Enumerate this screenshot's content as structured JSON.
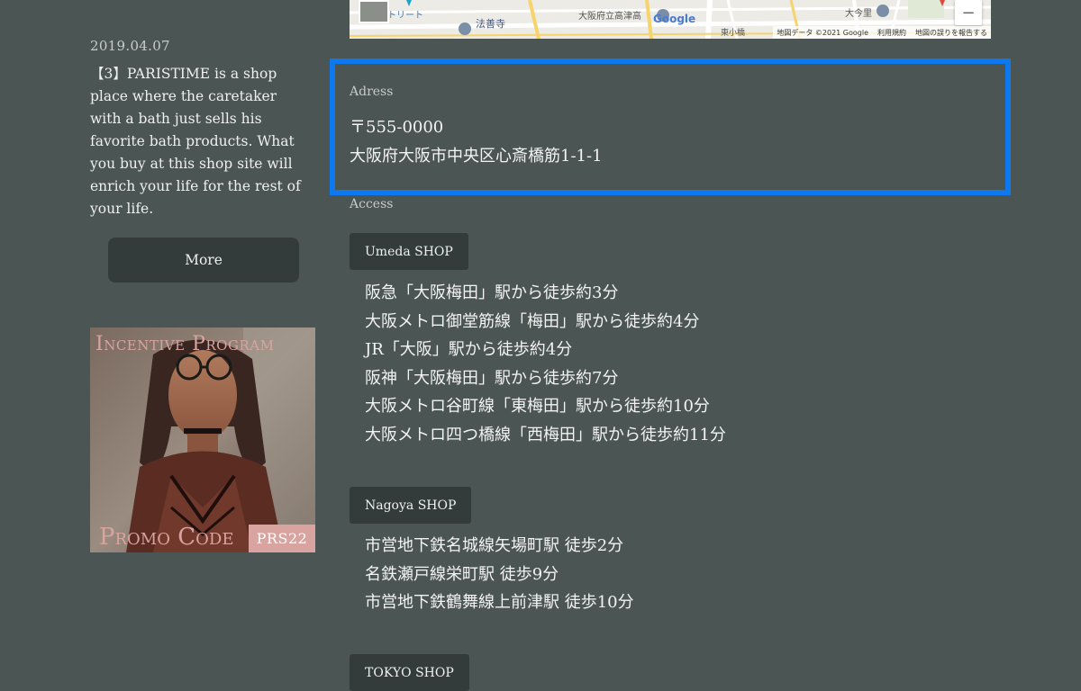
{
  "news": {
    "date": "2019.04.07",
    "text": "【3】PARISTIME is a shop place where the caretaker with a bath just sells his favorite bath products. What you buy at this shop site will enrich your life for the rest of your life.",
    "more_label": "More"
  },
  "promo": {
    "title": "Incentive Program",
    "code_label": "Promo Code",
    "code": "PRS22"
  },
  "map": {
    "labels": [
      "トリート",
      "法善寺",
      "大阪府立高津高",
      "大今里",
      "東小橋"
    ],
    "zoom_out_label": "−",
    "footer": [
      "地図データ ©2021 Google",
      "利用規約",
      "地図の誤りを報告する"
    ],
    "brand": "Google"
  },
  "address": {
    "label": "Adress",
    "postal": "〒555-0000",
    "street": "大阪府大阪市中央区心斎橋筋1-1-1"
  },
  "access": {
    "label": "Access",
    "shops": [
      {
        "name": "Umeda SHOP",
        "routes": [
          "阪急「大阪梅田」駅から徒歩約3分",
          "大阪メトロ御堂筋線「梅田」駅から徒歩約4分",
          "JR「大阪」駅から徒歩約4分",
          "阪神「大阪梅田」駅から徒歩約7分",
          "大阪メトロ谷町線「東梅田」駅から徒歩約10分",
          "大阪メトロ四つ橋線「西梅田」駅から徒歩約11分"
        ]
      },
      {
        "name": "Nagoya SHOP",
        "routes": [
          "市営地下鉄名城線矢場町駅 徒歩2分",
          "名鉄瀬戸線栄町駅 徒歩9分",
          "市営地下鉄鶴舞線上前津駅 徒歩10分"
        ]
      },
      {
        "name": "TOKYO SHOP",
        "routes": []
      }
    ]
  }
}
